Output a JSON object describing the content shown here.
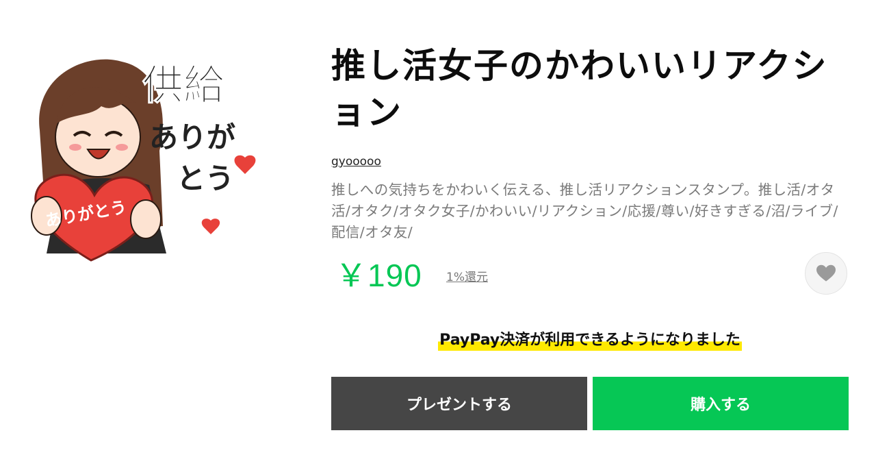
{
  "sticker": {
    "image_text": [
      "供給",
      "ありが",
      "とう"
    ],
    "heart_text": "ありがとう"
  },
  "product": {
    "title": "推し活女子のかわいいリアクション",
    "author": "gyooooo",
    "description": "推しへの気持ちをかわいく伝える、推し活リアクションスタンプ。推し活/オタ活/オタク/オタク女子/かわいい/リアクション/応援/尊い/好きすぎる/沼/ライブ/配信/オタ友/",
    "price": "￥190",
    "cashback": "1%還元"
  },
  "favorite": {
    "icon": "heart-icon"
  },
  "notice": "PayPay決済が利用できるようになりました",
  "buttons": {
    "present": "プレゼントする",
    "buy": "購入する"
  },
  "colors": {
    "accent": "#06c755",
    "present_button": "#464646",
    "highlight": "#ffe900",
    "heart": "#e8413a"
  }
}
